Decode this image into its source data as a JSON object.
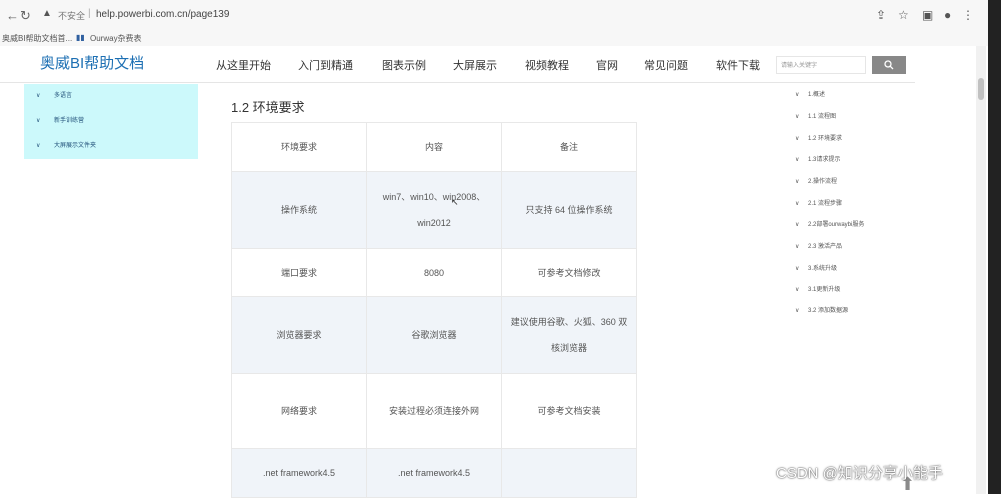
{
  "browser": {
    "insecure_label": "不安全",
    "url": "help.powerbi.com.cn/page139",
    "bookmarks": [
      "奥威BI帮助文档首...",
      "Ourway杂费表"
    ]
  },
  "site": {
    "logo": "奥威BI帮助文档",
    "nav": [
      "从这里开始",
      "入门到精通",
      "图表示例",
      "大屏展示",
      "视频教程",
      "官网",
      "常见问题",
      "软件下载"
    ],
    "search_placeholder": "请输入关键字",
    "search_icon": "search-icon"
  },
  "sidebar": {
    "items": [
      "多语言",
      "新手训练营",
      "大屏展示文件夹"
    ]
  },
  "main": {
    "title": "1.2 环境要求",
    "table": {
      "headers": [
        "环境要求",
        "内容",
        "备注"
      ],
      "rows": [
        [
          "操作系统",
          "win7、win10、win2008、win2012",
          "只支持 64 位操作系统"
        ],
        [
          "端口要求",
          "8080",
          "可参考文档修改"
        ],
        [
          "浏览器要求",
          "谷歌浏览器",
          "建议使用谷歌、火狐、360 双核浏览器"
        ],
        [
          "网络要求",
          "安装过程必须连接外网",
          "可参考文档安装"
        ],
        [
          ".net framework4.5",
          ".net framework4.5",
          ""
        ]
      ]
    }
  },
  "toc": {
    "items": [
      "1.概述",
      "1.1 流程图",
      "1.2 环境要求",
      "1.3请求提示",
      "2.操作流程",
      "2.1 流程步骤",
      "2.2部署ourwaybi服务",
      "2.3 激活产品",
      "3.系统升级",
      "3.1更新升级",
      "3.2 添加数据源"
    ]
  },
  "watermark": "CSDN @知识分享小能手"
}
